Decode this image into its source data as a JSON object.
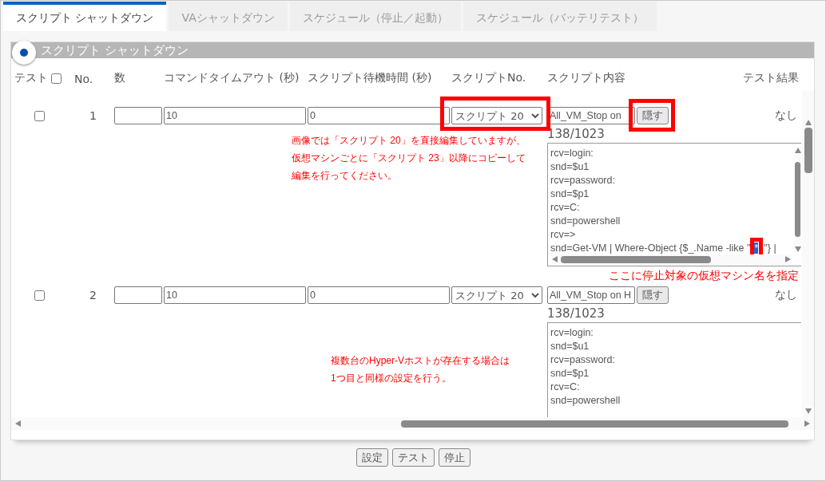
{
  "tabs": [
    {
      "label": "スクリプト シャットダウン",
      "selected": true
    },
    {
      "label": "VAシャットダウン",
      "selected": false
    },
    {
      "label": "スケジュール（停止／起動）",
      "selected": false
    },
    {
      "label": "スケジュール（バッテリテスト）",
      "selected": false
    }
  ],
  "panel": {
    "title": "スクリプト シャットダウン",
    "selected": true
  },
  "columns": {
    "test": "テスト",
    "test_all_checked": false,
    "no": "No.",
    "count": "数",
    "timeout": "コマンドタイムアウト (秒)",
    "wait": "スクリプト待機時間 (秒)",
    "script_no": "スクリプトNo.",
    "content": "スクリプト内容",
    "result": "テスト結果"
  },
  "rows": [
    {
      "checked": false,
      "no": "1",
      "timeout": "10",
      "wait": "0",
      "script": "スクリプト 20",
      "script_marked": true,
      "name": "All_VM_Stop on",
      "hide_label": "隠す",
      "hide_marked": true,
      "result": "なし",
      "char_count": "138/1023",
      "scrollbars": true,
      "lines": [
        {
          "kind": "text",
          "text": "rcv=login:"
        },
        {
          "kind": "text",
          "text": "snd=$u1"
        },
        {
          "kind": "text",
          "text": "rcv=password:"
        },
        {
          "kind": "text",
          "text": "snd=$p1"
        },
        {
          "kind": "text",
          "text": "rcv=C:"
        },
        {
          "kind": "text",
          "text": "snd=powershell"
        },
        {
          "kind": "text",
          "text": "rcv=>"
        },
        {
          "kind": "selection",
          "before": "snd=Get-VM | Where-Object {$_.Name -like \"",
          "selected": "*",
          "after": "\"} |",
          "marked": true
        }
      ],
      "side_note": [
        "画像では「スクリプト 20」を直接編集していますが、",
        "仮想マシンごとに「スクリプト 23」以降にコピーして",
        "編集を行ってください。"
      ],
      "below_note": "ここに停止対象の仮想マシン名を指定"
    },
    {
      "checked": false,
      "no": "2",
      "timeout": "10",
      "wait": "0",
      "script": "スクリプト 20",
      "script_marked": false,
      "name": "All_VM_Stop on H",
      "hide_label": "隠す",
      "hide_marked": false,
      "result": "なし",
      "char_count": "138/1023",
      "scrollbars": false,
      "lines": [
        {
          "kind": "text",
          "text": "rcv=login:"
        },
        {
          "kind": "text",
          "text": "snd=$u1"
        },
        {
          "kind": "text",
          "text": "rcv=password:"
        },
        {
          "kind": "text",
          "text": "snd=$p1"
        },
        {
          "kind": "text",
          "text": "rcv=C:"
        },
        {
          "kind": "text",
          "text": "snd=powershell"
        }
      ],
      "side_note": [
        "複数台のHyper-Vホストが存在する場合は",
        "1つ目と同様の設定を行う。"
      ]
    }
  ],
  "buttons": [
    "設定",
    "テスト",
    "停止"
  ]
}
